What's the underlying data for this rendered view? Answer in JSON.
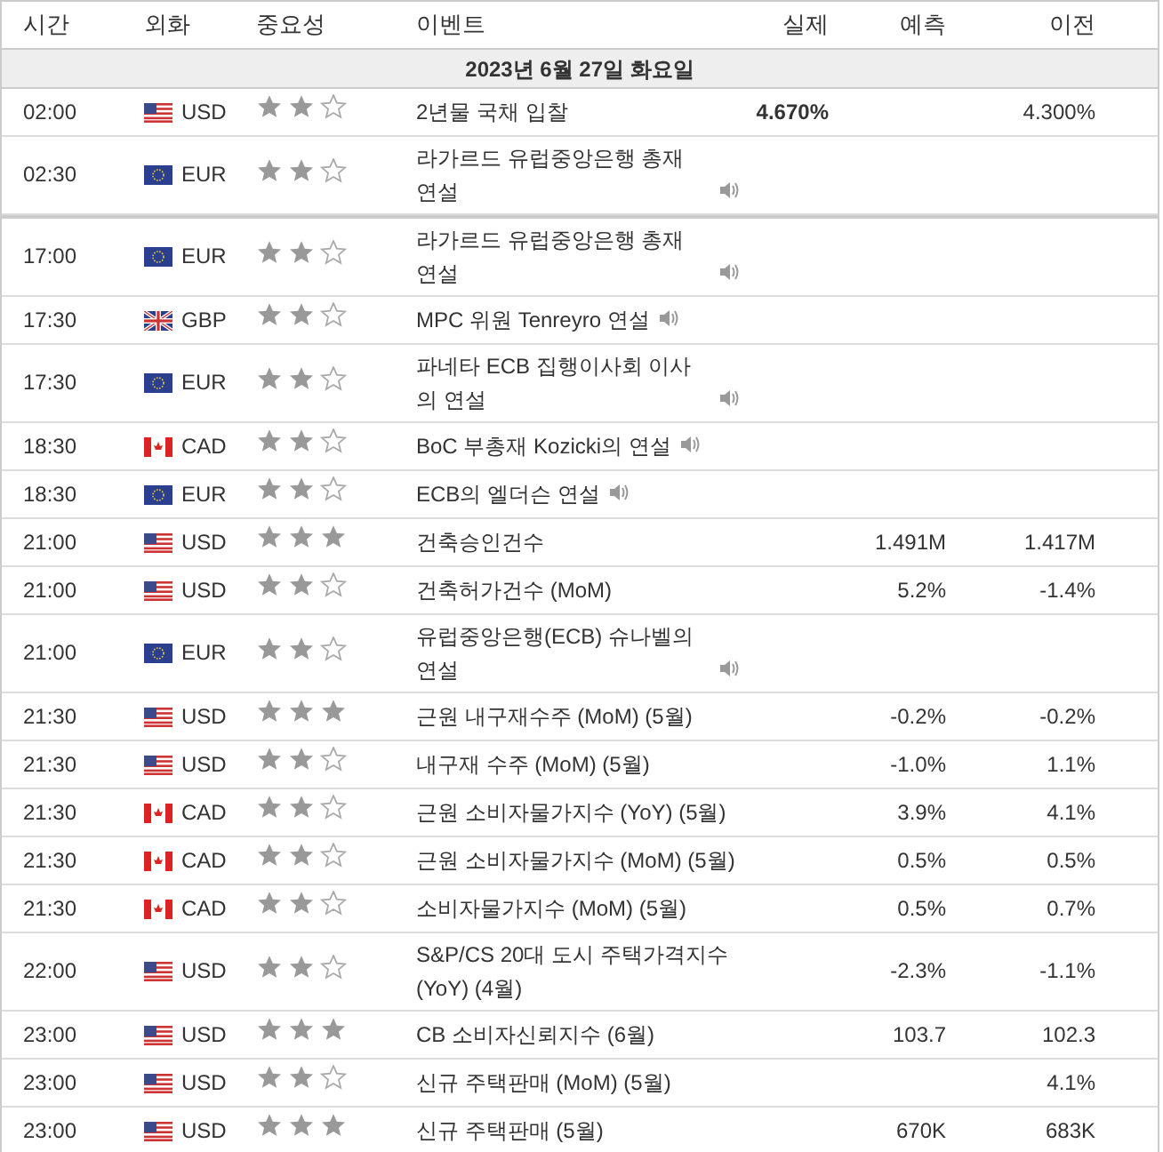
{
  "columns": [
    "시간",
    "외화",
    "중요성",
    "이벤트",
    "실제",
    "예측",
    "이전"
  ],
  "date": "2023년 6월 27일 화요일",
  "rows": [
    {
      "time": "02:00",
      "kind": "us",
      "currency": "USD",
      "stars": 2,
      "event": "2년물 국채 입찰",
      "speech": false,
      "actual": "4.670%",
      "forecast": "",
      "previous": "4.300%",
      "break_before": false
    },
    {
      "time": "02:30",
      "kind": "eu",
      "currency": "EUR",
      "stars": 2,
      "event": "라가르드 유럽중앙은행 총재 연설",
      "speech": true,
      "actual": "",
      "forecast": "",
      "previous": "",
      "break_before": false
    },
    {
      "time": "17:00",
      "kind": "eu",
      "currency": "EUR",
      "stars": 2,
      "event": "라가르드 유럽중앙은행 총재 연설",
      "speech": true,
      "actual": "",
      "forecast": "",
      "previous": "",
      "break_before": true
    },
    {
      "time": "17:30",
      "kind": "gb",
      "currency": "GBP",
      "stars": 2,
      "event": "MPC 위원 Tenreyro 연설",
      "speech": true,
      "actual": "",
      "forecast": "",
      "previous": "",
      "break_before": false
    },
    {
      "time": "17:30",
      "kind": "eu",
      "currency": "EUR",
      "stars": 2,
      "event": "파네타 ECB 집행이사회 이사의 연설",
      "speech": true,
      "actual": "",
      "forecast": "",
      "previous": "",
      "break_before": false
    },
    {
      "time": "18:30",
      "kind": "ca",
      "currency": "CAD",
      "stars": 2,
      "event": "BoC 부총재 Kozicki의 연설",
      "speech": true,
      "actual": "",
      "forecast": "",
      "previous": "",
      "break_before": false
    },
    {
      "time": "18:30",
      "kind": "eu",
      "currency": "EUR",
      "stars": 2,
      "event": "ECB의 엘더슨 연설",
      "speech": true,
      "actual": "",
      "forecast": "",
      "previous": "",
      "break_before": false
    },
    {
      "time": "21:00",
      "kind": "us",
      "currency": "USD",
      "stars": 3,
      "event": "건축승인건수",
      "speech": false,
      "actual": "",
      "forecast": "1.491M",
      "previous": "1.417M",
      "break_before": false
    },
    {
      "time": "21:00",
      "kind": "us",
      "currency": "USD",
      "stars": 2,
      "event": "건축허가건수 (MoM)",
      "speech": false,
      "actual": "",
      "forecast": "5.2%",
      "previous": "-1.4%",
      "break_before": false
    },
    {
      "time": "21:00",
      "kind": "eu",
      "currency": "EUR",
      "stars": 2,
      "event": "유럽중앙은행(ECB) 슈나벨의 연설",
      "speech": true,
      "actual": "",
      "forecast": "",
      "previous": "",
      "break_before": false
    },
    {
      "time": "21:30",
      "kind": "us",
      "currency": "USD",
      "stars": 3,
      "event": "근원 내구재수주 (MoM) (5월)",
      "speech": false,
      "actual": "",
      "forecast": "-0.2%",
      "previous": "-0.2%",
      "break_before": false
    },
    {
      "time": "21:30",
      "kind": "us",
      "currency": "USD",
      "stars": 2,
      "event": "내구재 수주 (MoM) (5월)",
      "speech": false,
      "actual": "",
      "forecast": "-1.0%",
      "previous": "1.1%",
      "break_before": false
    },
    {
      "time": "21:30",
      "kind": "ca",
      "currency": "CAD",
      "stars": 2,
      "event": "근원 소비자물가지수 (YoY) (5월)",
      "speech": false,
      "actual": "",
      "forecast": "3.9%",
      "previous": "4.1%",
      "break_before": false
    },
    {
      "time": "21:30",
      "kind": "ca",
      "currency": "CAD",
      "stars": 2,
      "event": "근원 소비자물가지수 (MoM) (5월)",
      "speech": false,
      "actual": "",
      "forecast": "0.5%",
      "previous": "0.5%",
      "break_before": false
    },
    {
      "time": "21:30",
      "kind": "ca",
      "currency": "CAD",
      "stars": 2,
      "event": "소비자물가지수 (MoM) (5월)",
      "speech": false,
      "actual": "",
      "forecast": "0.5%",
      "previous": "0.7%",
      "break_before": false
    },
    {
      "time": "22:00",
      "kind": "us",
      "currency": "USD",
      "stars": 2,
      "event": "S&P/CS 20대 도시 주택가격지수 (YoY) (4월)",
      "speech": false,
      "actual": "",
      "forecast": "-2.3%",
      "previous": "-1.1%",
      "break_before": false
    },
    {
      "time": "23:00",
      "kind": "us",
      "currency": "USD",
      "stars": 3,
      "event": "CB 소비자신뢰지수 (6월)",
      "speech": false,
      "actual": "",
      "forecast": "103.7",
      "previous": "102.3",
      "break_before": false
    },
    {
      "time": "23:00",
      "kind": "us",
      "currency": "USD",
      "stars": 2,
      "event": "신규 주택판매 (MoM) (5월)",
      "speech": false,
      "actual": "",
      "forecast": "",
      "previous": "4.1%",
      "break_before": false
    },
    {
      "time": "23:00",
      "kind": "us",
      "currency": "USD",
      "stars": 3,
      "event": "신규 주택판매 (5월)",
      "speech": false,
      "actual": "",
      "forecast": "670K",
      "previous": "683K",
      "break_before": false
    }
  ]
}
